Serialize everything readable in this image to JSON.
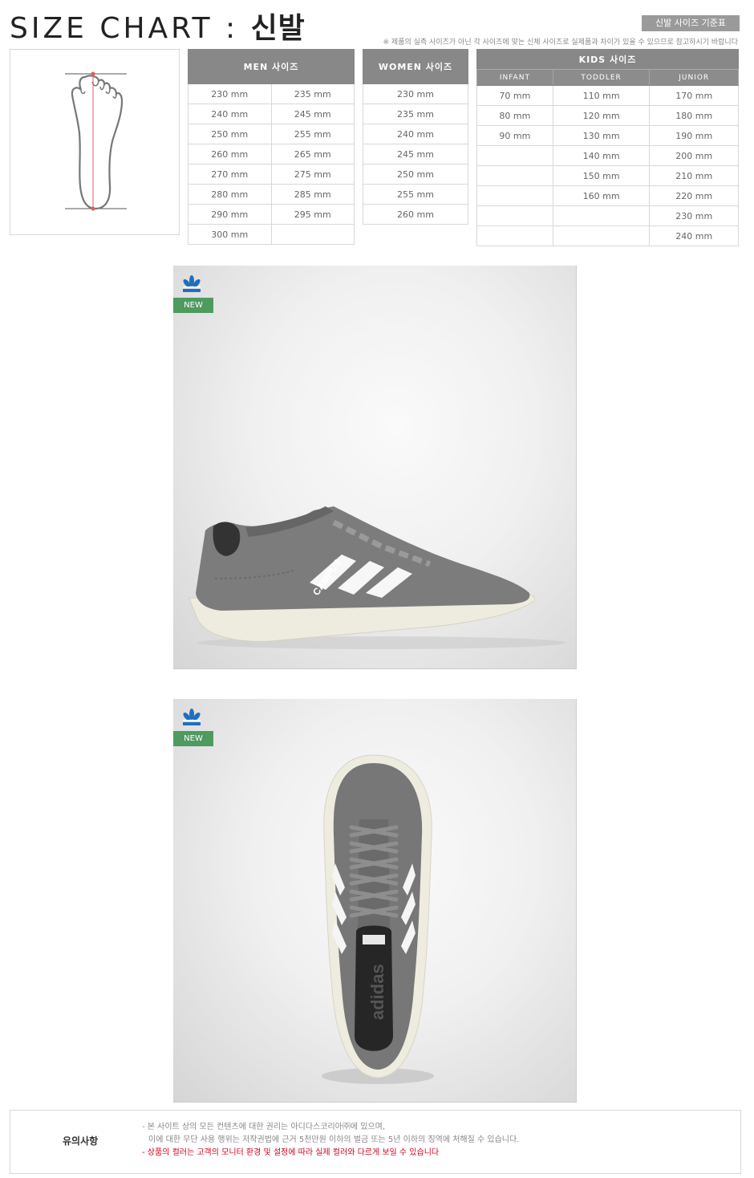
{
  "title": {
    "main": "SIZE CHART : ",
    "bold": "신발"
  },
  "standard_badge": "신발 사이즈 기준표",
  "notice": "※ 제품의 실측 사이즈가 아닌 각 사이즈에 맞는 신체 사이즈로 실제품과 차이가 있을 수 있으므로 참고하시기 바랍니다",
  "men": {
    "header": "MEN 사이즈",
    "rows": [
      [
        "230 mm",
        "235 mm"
      ],
      [
        "240 mm",
        "245 mm"
      ],
      [
        "250 mm",
        "255 mm"
      ],
      [
        "260 mm",
        "265 mm"
      ],
      [
        "270 mm",
        "275 mm"
      ],
      [
        "280 mm",
        "285 mm"
      ],
      [
        "290 mm",
        "295 mm"
      ],
      [
        "300 mm",
        ""
      ]
    ]
  },
  "women": {
    "header": "WOMEN 사이즈",
    "rows": [
      "230 mm",
      "235 mm",
      "240 mm",
      "245 mm",
      "250 mm",
      "255 mm",
      "260 mm"
    ]
  },
  "kids": {
    "header": "KIDS 사이즈",
    "subheaders": [
      "INFANT",
      "TODDLER",
      "JUNIOR"
    ],
    "rows": [
      [
        "70 mm",
        "110 mm",
        "170 mm"
      ],
      [
        "80 mm",
        "120 mm",
        "180 mm"
      ],
      [
        "90 mm",
        "130 mm",
        "190 mm"
      ],
      [
        "",
        "140 mm",
        "200 mm"
      ],
      [
        "",
        "150 mm",
        "210 mm"
      ],
      [
        "",
        "160 mm",
        "220 mm"
      ],
      [
        "",
        "",
        "230 mm"
      ],
      [
        "",
        "",
        "240 mm"
      ]
    ]
  },
  "photos": [
    {
      "badge": "NEW",
      "shoe_text": "CAMPUS",
      "colors": {
        "upper": "#7c7c7c",
        "sole": "#eeecdf"
      }
    },
    {
      "badge": "NEW",
      "shoe_text": "adidas",
      "colors": {
        "upper": "#777777",
        "sole": "#eeecdf"
      }
    }
  ],
  "caution": {
    "heading": "유의사항",
    "line1": "- 본 사이트 상의 모든 컨텐츠에 대한 권리는 아디다스코리아㈜에 있으며,",
    "line2": "이에 대한 무단 사용 행위는 저작권법에 근거 5천만원 이하의 벌금 또는 5년 이하의 징역에 처해질 수 있습니다.",
    "line3": "- 상품의 컬러는 고객의 모니터 환경 및 설정에 따라 실제 컬러와 다르게 보일 수 있습니다"
  },
  "colors": {
    "header_gray": "#888888",
    "new_green": "#4f9a5f",
    "adidas_blue": "#1f6fc0",
    "warning_red": "#d0021b"
  }
}
